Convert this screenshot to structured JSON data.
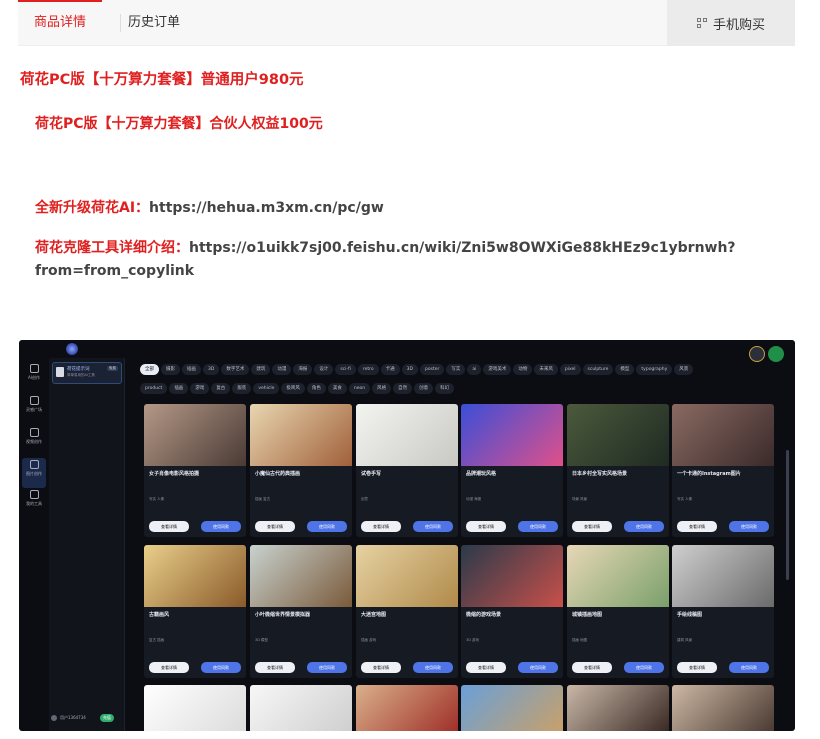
{
  "tabs": {
    "details": "商品详情",
    "history": "历史订单",
    "mobile_buy": "手机购买"
  },
  "content": {
    "line1": "荷花PC版【十万算力套餐】普通用户980元",
    "line2": "荷花PC版【十万算力套餐】合伙人权益100元",
    "line3_label": "全新升级荷花AI：",
    "line3_url": "https://hehua.m3xm.cn/pc/gw",
    "line4_label": "荷花克隆工具详细介绍：",
    "line4_url": "https://o1uikk7sj00.feishu.cn/wiki/Zni5w8OWXiGe88kHEz9c1ybrnwh?",
    "line5_url": "from=from_copylink"
  },
  "app": {
    "nav": [
      "AI创作",
      "灵感广场",
      "视频创作",
      "图片创作",
      "我的工具"
    ],
    "project": {
      "title": "荷花提示词",
      "subtitle": "简单易用的AI工具",
      "badge": "免费"
    },
    "user": {
      "name": "用户1364734",
      "button": "充值"
    },
    "chips_row1": [
      "全部",
      "摄影",
      "插画",
      "3D",
      "数字艺术",
      "建筑",
      "动漫",
      "海报",
      "设计",
      "sci-fi",
      "retro",
      "卡通",
      "3D",
      "poster",
      "写实",
      "ai",
      "游戏美术",
      "动物",
      "未来风",
      "pixel",
      "sculpture",
      "模型",
      "typography",
      "风景"
    ],
    "chips_row2": [
      "product",
      "插画",
      "游戏",
      "复古",
      "服装",
      "vehicle",
      "极简风",
      "角色",
      "美食",
      "neon",
      "风格",
      "自然",
      "创意",
      "科幻"
    ],
    "cards_row1": [
      {
        "title": "女子肖像电影风格拍摄",
        "tags": "写实  人像",
        "colors": [
          "#b59887",
          "#4a3b35"
        ]
      },
      {
        "title": "小魔仙古代药典插画",
        "tags": "插画  复古",
        "colors": [
          "#e8d6b0",
          "#a0603a"
        ]
      },
      {
        "title": "试卷手写",
        "tags": "创意",
        "colors": [
          "#f3f3f0",
          "#c9c9c4"
        ]
      },
      {
        "title": "品牌潮玩风格",
        "tags": "动漫  海报",
        "colors": [
          "#3a4fd8",
          "#e0508a"
        ]
      },
      {
        "title": "日本乡村全写实风格场景",
        "tags": "场景  风景",
        "colors": [
          "#4b5a3c",
          "#1f2a22"
        ]
      },
      {
        "title": "一个卡通的Instagram图片",
        "tags": "写实  人像",
        "colors": [
          "#8a6a62",
          "#3a2a2a"
        ]
      }
    ],
    "cards_row2": [
      {
        "title": "古籍画风",
        "tags": "复古  插画",
        "colors": [
          "#e9cf8a",
          "#8a5a2a"
        ]
      },
      {
        "title": "小叶微缩世界情景模拟器",
        "tags": "3D  模型",
        "colors": [
          "#c8d2cf",
          "#7a5a3a"
        ]
      },
      {
        "title": "大迷宫地图",
        "tags": "插画  游戏",
        "colors": [
          "#e6d2a2",
          "#b08a4a"
        ]
      },
      {
        "title": "微缩的游戏场景",
        "tags": "3D  游戏",
        "colors": [
          "#2a3a4a",
          "#c8504a"
        ]
      },
      {
        "title": "城镇插画地图",
        "tags": "插画  地图",
        "colors": [
          "#e7d7b6",
          "#7aa06a"
        ]
      },
      {
        "title": "手绘线稿图",
        "tags": "建筑  风景",
        "colors": [
          "#cfcfcf",
          "#6a6a6a"
        ]
      }
    ],
    "card_buttons": {
      "left": "查看详情",
      "right": "使用同款"
    },
    "cards_row3_colors": [
      [
        "#ffffff",
        "#dcdcdc"
      ],
      [
        "#f7f7f7",
        "#cfcfcf"
      ],
      [
        "#d9b08a",
        "#a0302a"
      ],
      [
        "#6aa0d8",
        "#c8a06a"
      ],
      [
        "#c9b8a8",
        "#3a2a24"
      ],
      [
        "#cdb8a4",
        "#4a3a32"
      ]
    ]
  }
}
